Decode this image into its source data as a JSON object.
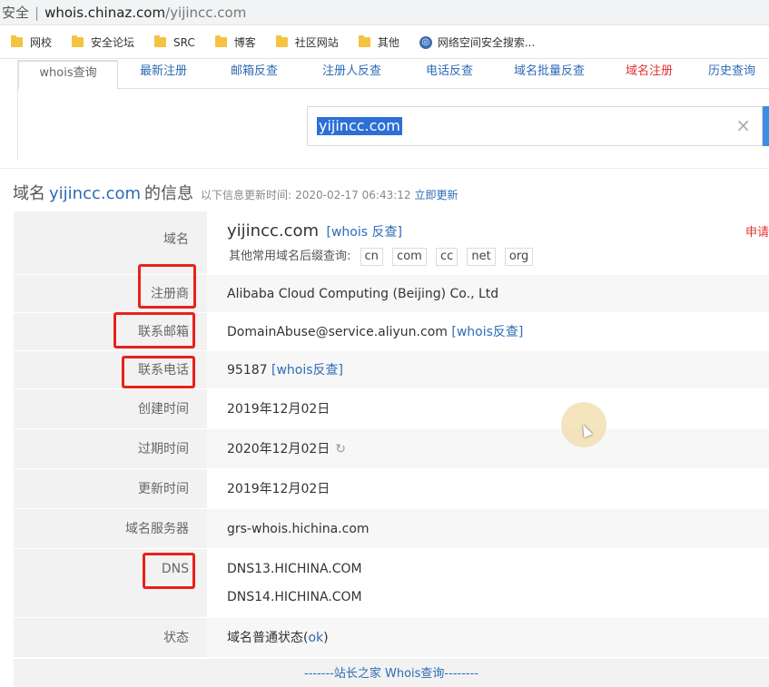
{
  "address_bar": {
    "secure": "安全",
    "host": "whois.chinaz.com",
    "path": "/yijincc.com"
  },
  "bookmarks": [
    "网校",
    "安全论坛",
    "SRC",
    "博客",
    "社区网站",
    "其他",
    "网络空间安全搜索..."
  ],
  "tabs": [
    {
      "label": "whois查询",
      "state": "active"
    },
    {
      "label": "最新注册",
      "state": ""
    },
    {
      "label": "邮箱反查",
      "state": ""
    },
    {
      "label": "注册人反查",
      "state": ""
    },
    {
      "label": "电话反查",
      "state": ""
    },
    {
      "label": "域名批量反查",
      "state": ""
    },
    {
      "label": "域名注册",
      "state": "red"
    },
    {
      "label": "历史查询",
      "state": ""
    }
  ],
  "search": {
    "value": "yijincc.com",
    "clear_icon": "×"
  },
  "heading": {
    "prefix": "域名",
    "domain": "yijincc.com",
    "suffix": "的信息",
    "update_label": "以下信息更新时间:",
    "update_time": "2020-02-17 06:43:12",
    "refresh_link": "立即更新"
  },
  "rows": {
    "domain": {
      "key": "域名",
      "value": "yijincc.com",
      "link": "[whois 反查]",
      "suffix_label": "其他常用域名后缀查询:",
      "suffixes": [
        "cn",
        "com",
        "cc",
        "net",
        "org"
      ],
      "apply": "申请"
    },
    "registrar": {
      "key": "注册商",
      "value": "Alibaba Cloud Computing (Beijing) Co., Ltd"
    },
    "email": {
      "key": "联系邮箱",
      "value": "DomainAbuse@service.aliyun.com",
      "link": "[whois反查]"
    },
    "phone": {
      "key": "联系电话",
      "value": "95187",
      "link": "[whois反查]"
    },
    "created": {
      "key": "创建时间",
      "value": "2019年12月02日"
    },
    "expires": {
      "key": "过期时间",
      "value": "2020年12月02日"
    },
    "updated": {
      "key": "更新时间",
      "value": "2019年12月02日"
    },
    "whois_server": {
      "key": "域名服务器",
      "value": "grs-whois.hichina.com"
    },
    "dns": {
      "key": "DNS",
      "values": [
        "DNS13.HICHINA.COM",
        "DNS14.HICHINA.COM"
      ]
    },
    "status": {
      "key": "状态",
      "value": "域名普通状态",
      "ok": "ok"
    }
  },
  "footer": "-------站长之家 Whois查询--------",
  "colors": {
    "link": "#2d6bb5",
    "highlight_box": "#e8211b"
  }
}
